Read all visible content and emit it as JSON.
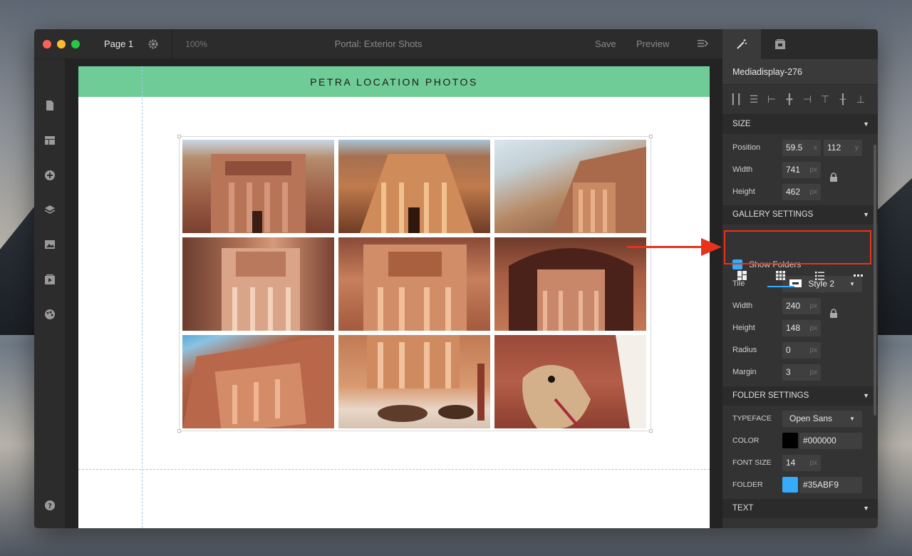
{
  "window": {
    "page_label": "Page 1",
    "zoom": "100%",
    "title": "Portal: Exterior Shots",
    "save_label": "Save",
    "preview_label": "Preview",
    "traffic_lights": [
      "#fe5f57",
      "#febc2e",
      "#28c840"
    ]
  },
  "page": {
    "banner_title": "PETRA LOCATION PHOTOS",
    "banner_color": "#6fcc97"
  },
  "panel": {
    "element_name": "Mediadisplay-276",
    "size": {
      "header": "SIZE",
      "position_label": "Position",
      "position_x": "59.5",
      "position_x_unit": "x",
      "position_y": "112",
      "position_y_unit": "y",
      "width_label": "Width",
      "width_value": "741",
      "height_label": "Height",
      "height_value": "462",
      "unit": "px"
    },
    "gallery": {
      "header": "GALLERY SETTINGS",
      "show_folders_label": "Show Folders",
      "tile_label": "Tile",
      "tile_value": "Style 2",
      "width_label": "Width",
      "width_value": "240",
      "height_label": "Height",
      "height_value": "148",
      "radius_label": "Radius",
      "radius_value": "0",
      "margin_label": "Margin",
      "margin_value": "3",
      "unit": "px"
    },
    "folder": {
      "header": "FOLDER SETTINGS",
      "typeface_label": "TYPEFACE",
      "typeface_value": "Open Sans",
      "color_label": "COLOR",
      "color_value": "#000000",
      "font_size_label": "FONT SIZE",
      "font_size_value": "14",
      "folder_label": "FOLDER",
      "folder_value": "#35ABF9",
      "unit": "px"
    },
    "text": {
      "header": "TEXT"
    },
    "accent_color": "#35abf9",
    "highlight_color": "#e8321b"
  }
}
